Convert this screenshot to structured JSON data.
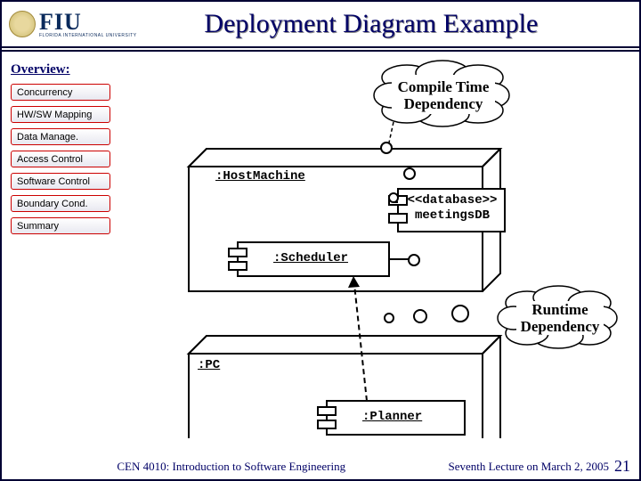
{
  "title": "Deployment Diagram Example",
  "logo": {
    "fiu": "FIU",
    "sub": "FLORIDA INTERNATIONAL UNIVERSITY"
  },
  "overview_label": "Overview:",
  "nav": [
    "Concurrency",
    "HW/SW Mapping",
    "Data Manage.",
    "Access Control",
    "Software Control",
    "Boundary Cond.",
    "Summary"
  ],
  "diagram": {
    "cloud1": "Compile Time\nDependency",
    "cloud2": "Runtime\nDependency",
    "host_node": ":HostMachine",
    "pc_node": ":PC",
    "scheduler_comp": ":Scheduler",
    "planner_comp": ":Planner",
    "db_stereotype": "<<database>>",
    "db_name": "meetingsDB"
  },
  "footer": {
    "center": "CEN 4010: Introduction to Software Engineering",
    "right": "Seventh Lecture on March 2, 2005"
  },
  "page": "21"
}
